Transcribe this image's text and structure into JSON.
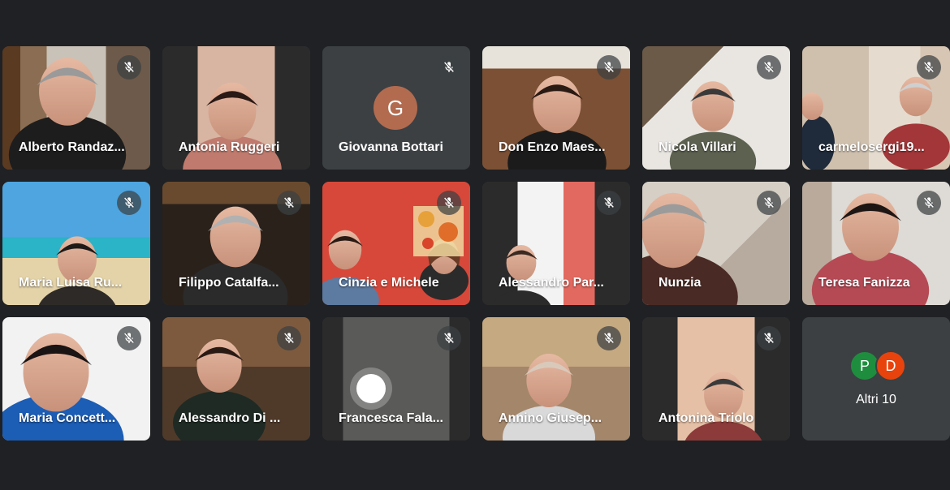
{
  "participants": [
    {
      "name": "Alberto Randaz...",
      "video": "v1",
      "muted": true
    },
    {
      "name": "Antonia Ruggeri",
      "video": "v2",
      "muted": false
    },
    {
      "name": "Giovanna Bottari",
      "video": "none",
      "avatar": "G",
      "muted": true
    },
    {
      "name": "Don Enzo Maes...",
      "video": "v4",
      "muted": true
    },
    {
      "name": "Nicola Villari",
      "video": "v5",
      "muted": true
    },
    {
      "name": "carmelosergi19...",
      "video": "v6",
      "muted": true
    },
    {
      "name": "Maria Luisa Ru...",
      "video": "v7",
      "muted": true
    },
    {
      "name": "Filippo Catalfa...",
      "video": "v8",
      "muted": true
    },
    {
      "name": "Cinzia e Michele",
      "video": "v9",
      "muted": true
    },
    {
      "name": "Alessandro Par...",
      "video": "v10",
      "muted": true
    },
    {
      "name": "Nunzia",
      "video": "v11",
      "muted": true
    },
    {
      "name": "Teresa Fanizza",
      "video": "v12",
      "muted": true
    },
    {
      "name": "Maria Concett...",
      "video": "v13",
      "muted": true
    },
    {
      "name": "Alessandro Di ...",
      "video": "v14",
      "muted": true
    },
    {
      "name": "Francesca Fala...",
      "video": "v15",
      "muted": true
    },
    {
      "name": "Annino Giusep...",
      "video": "v16",
      "muted": true
    },
    {
      "name": "Antonina Triolo",
      "video": "v17",
      "muted": true
    }
  ],
  "more": {
    "label": "Altri 10",
    "avatars": [
      "P",
      "D"
    ],
    "colors": [
      "#1e8e3e",
      "#e8430c"
    ]
  },
  "icons": {
    "mute": "mic-off-icon"
  },
  "colors": {
    "background": "#202124",
    "tile": "#3c4043",
    "avatar_g": "#b26b4f"
  }
}
